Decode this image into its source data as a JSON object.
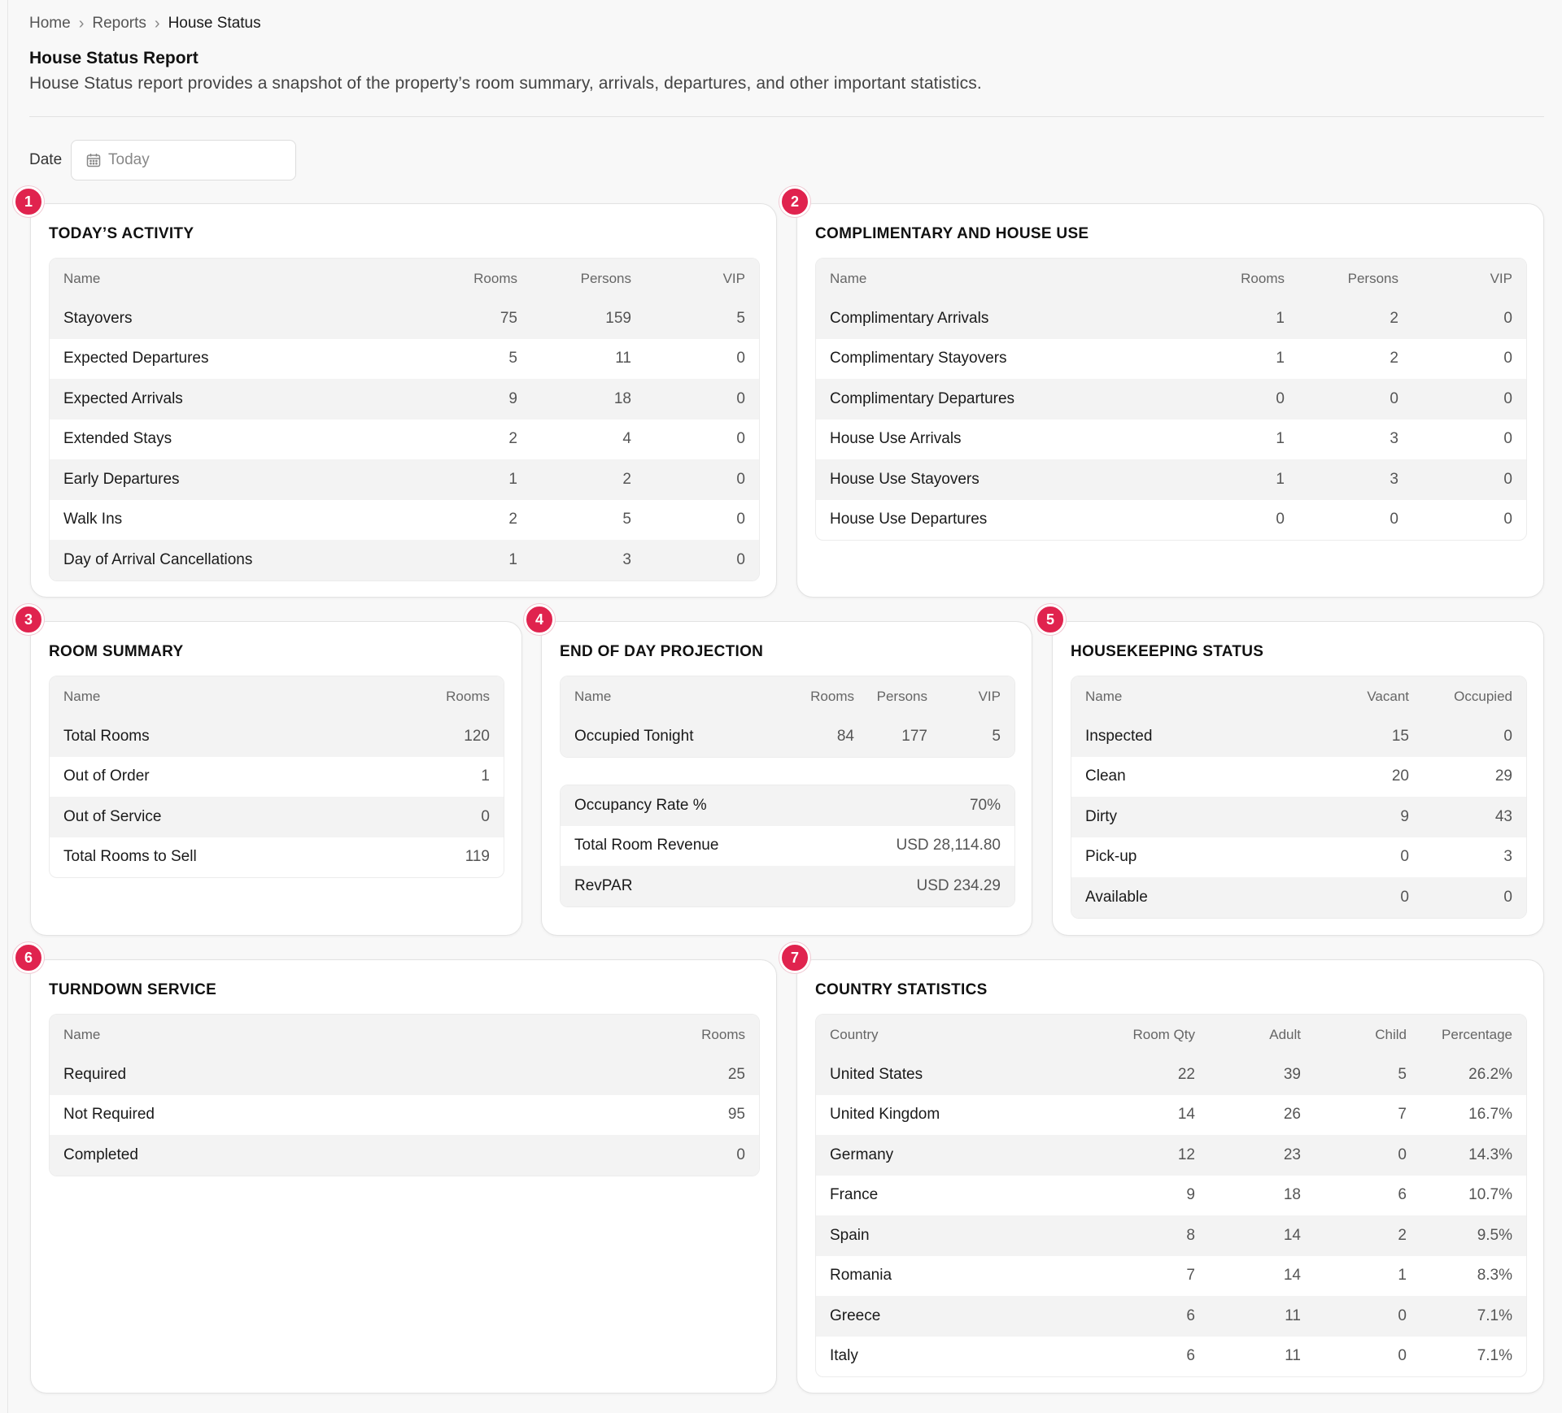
{
  "breadcrumb": [
    "Home",
    "Reports",
    "House Status"
  ],
  "page": {
    "title": "House Status Report",
    "description": "House Status report provides a snapshot of the property’s room summary, arrivals, departures, and other important statistics."
  },
  "date_filter": {
    "label": "Date",
    "placeholder": "Today",
    "icon": "calendar-icon"
  },
  "colors": {
    "badge": "#e0234e",
    "row_shade": "#f3f3f3"
  },
  "sections": {
    "todays_activity": {
      "badge": "1",
      "title": "TODAY’S ACTIVITY",
      "headers": [
        "Name",
        "Rooms",
        "Persons",
        "VIP"
      ],
      "rows": [
        [
          "Stayovers",
          "75",
          "159",
          "5"
        ],
        [
          "Expected Departures",
          "5",
          "11",
          "0"
        ],
        [
          "Expected Arrivals",
          "9",
          "18",
          "0"
        ],
        [
          "Extended Stays",
          "2",
          "4",
          "0"
        ],
        [
          "Early Departures",
          "1",
          "2",
          "0"
        ],
        [
          "Walk Ins",
          "2",
          "5",
          "0"
        ],
        [
          "Day of Arrival Cancellations",
          "1",
          "3",
          "0"
        ]
      ]
    },
    "complimentary": {
      "badge": "2",
      "title": "COMPLIMENTARY AND HOUSE USE",
      "headers": [
        "Name",
        "Rooms",
        "Persons",
        "VIP"
      ],
      "rows": [
        [
          "Complimentary Arrivals",
          "1",
          "2",
          "0"
        ],
        [
          "Complimentary Stayovers",
          "1",
          "2",
          "0"
        ],
        [
          "Complimentary Departures",
          "0",
          "0",
          "0"
        ],
        [
          "House Use Arrivals",
          "1",
          "3",
          "0"
        ],
        [
          "House Use Stayovers",
          "1",
          "3",
          "0"
        ],
        [
          "House Use Departures",
          "0",
          "0",
          "0"
        ]
      ]
    },
    "room_summary": {
      "badge": "3",
      "title": "ROOM SUMMARY",
      "headers": [
        "Name",
        "Rooms"
      ],
      "rows": [
        [
          "Total Rooms",
          "120"
        ],
        [
          "Out of Order",
          "1"
        ],
        [
          "Out of Service",
          "0"
        ],
        [
          "Total Rooms to Sell",
          "119"
        ]
      ]
    },
    "end_of_day": {
      "badge": "4",
      "title": "END OF DAY PROJECTION",
      "headers": [
        "Name",
        "Rooms",
        "Persons",
        "VIP"
      ],
      "rows": [
        [
          "Occupied Tonight",
          "84",
          "177",
          "5"
        ]
      ],
      "stats": [
        [
          "Occupancy Rate %",
          "70%"
        ],
        [
          "Total Room Revenue",
          "USD 28,114.80"
        ],
        [
          "RevPAR",
          "USD 234.29"
        ]
      ]
    },
    "housekeeping": {
      "badge": "5",
      "title": "HOUSEKEEPING STATUS",
      "headers": [
        "Name",
        "Vacant",
        "Occupied"
      ],
      "rows": [
        [
          "Inspected",
          "15",
          "0"
        ],
        [
          "Clean",
          "20",
          "29"
        ],
        [
          "Dirty",
          "9",
          "43"
        ],
        [
          "Pick-up",
          "0",
          "3"
        ],
        [
          "Available",
          "0",
          "0"
        ]
      ]
    },
    "turndown": {
      "badge": "6",
      "title": "TURNDOWN SERVICE",
      "headers": [
        "Name",
        "Rooms"
      ],
      "rows": [
        [
          "Required",
          "25"
        ],
        [
          "Not Required",
          "95"
        ],
        [
          "Completed",
          "0"
        ]
      ]
    },
    "country_stats": {
      "badge": "7",
      "title": "COUNTRY STATISTICS",
      "headers": [
        "Country",
        "Room Qty",
        "Adult",
        "Child",
        "Percentage"
      ],
      "rows": [
        [
          "United States",
          "22",
          "39",
          "5",
          "26.2%"
        ],
        [
          "United Kingdom",
          "14",
          "26",
          "7",
          "16.7%"
        ],
        [
          "Germany",
          "12",
          "23",
          "0",
          "14.3%"
        ],
        [
          "France",
          "9",
          "18",
          "6",
          "10.7%"
        ],
        [
          "Spain",
          "8",
          "14",
          "2",
          "9.5%"
        ],
        [
          "Romania",
          "7",
          "14",
          "1",
          "8.3%"
        ],
        [
          "Greece",
          "6",
          "11",
          "0",
          "7.1%"
        ],
        [
          "Italy",
          "6",
          "11",
          "0",
          "7.1%"
        ]
      ]
    }
  }
}
